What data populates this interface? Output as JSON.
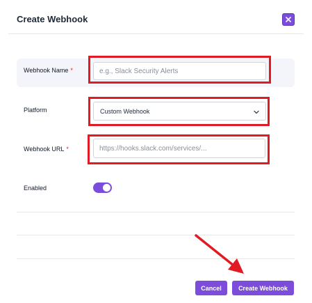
{
  "dialog": {
    "title": "Create Webhook"
  },
  "form": {
    "webhook_name": {
      "label": "Webhook Name",
      "required_mark": "*",
      "value": "",
      "placeholder": "e.g., Slack Security Alerts"
    },
    "platform": {
      "label": "Platform",
      "selected": "Custom Webhook"
    },
    "webhook_url": {
      "label": "Webhook URL",
      "required_mark": "*",
      "value": "",
      "placeholder": "https://hooks.slack.com/services/..."
    },
    "enabled": {
      "label": "Enabled",
      "checked": true
    }
  },
  "footer": {
    "cancel_label": "Cancel",
    "create_label": "Create Webhook"
  },
  "icons": {
    "close": "close-icon",
    "dropdown": "chevron-down-icon"
  },
  "colors": {
    "accent": "#7c4ddb",
    "annotation": "#e01b24",
    "required": "#dc2626"
  }
}
